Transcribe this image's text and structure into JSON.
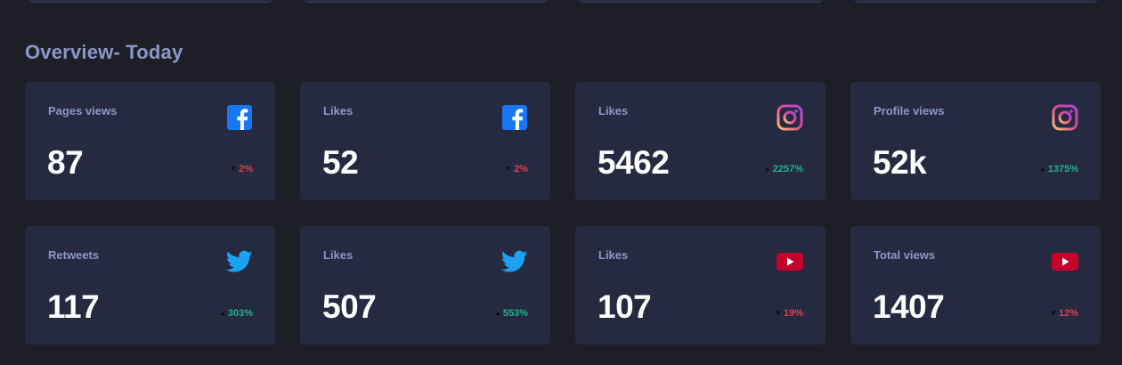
{
  "overview": {
    "title": "Overview- Today"
  },
  "colors": {
    "background": "#1e1f26",
    "card": "#252a41",
    "label": "#8b97c6",
    "up": "#1db489",
    "down": "#dc414c",
    "facebook": "#1877f2",
    "twitter": "#1da1f2",
    "youtube": "#c4032a"
  },
  "cards": [
    {
      "label": "Pages views",
      "value": "87",
      "change": "2%",
      "trend": "down",
      "icon": "facebook-icon"
    },
    {
      "label": "Likes",
      "value": "52",
      "change": "2%",
      "trend": "down",
      "icon": "facebook-icon"
    },
    {
      "label": "Likes",
      "value": "5462",
      "change": "2257%",
      "trend": "up",
      "icon": "instagram-icon"
    },
    {
      "label": "Profile views",
      "value": "52k",
      "change": "1375%",
      "trend": "up",
      "icon": "instagram-icon"
    },
    {
      "label": "Retweets",
      "value": "117",
      "change": "303%",
      "trend": "up",
      "icon": "twitter-icon"
    },
    {
      "label": "Likes",
      "value": "507",
      "change": "553%",
      "trend": "up",
      "icon": "twitter-icon"
    },
    {
      "label": "Likes",
      "value": "107",
      "change": "19%",
      "trend": "down",
      "icon": "youtube-icon"
    },
    {
      "label": "Total views",
      "value": "1407",
      "change": "12%",
      "trend": "down",
      "icon": "youtube-icon"
    }
  ]
}
